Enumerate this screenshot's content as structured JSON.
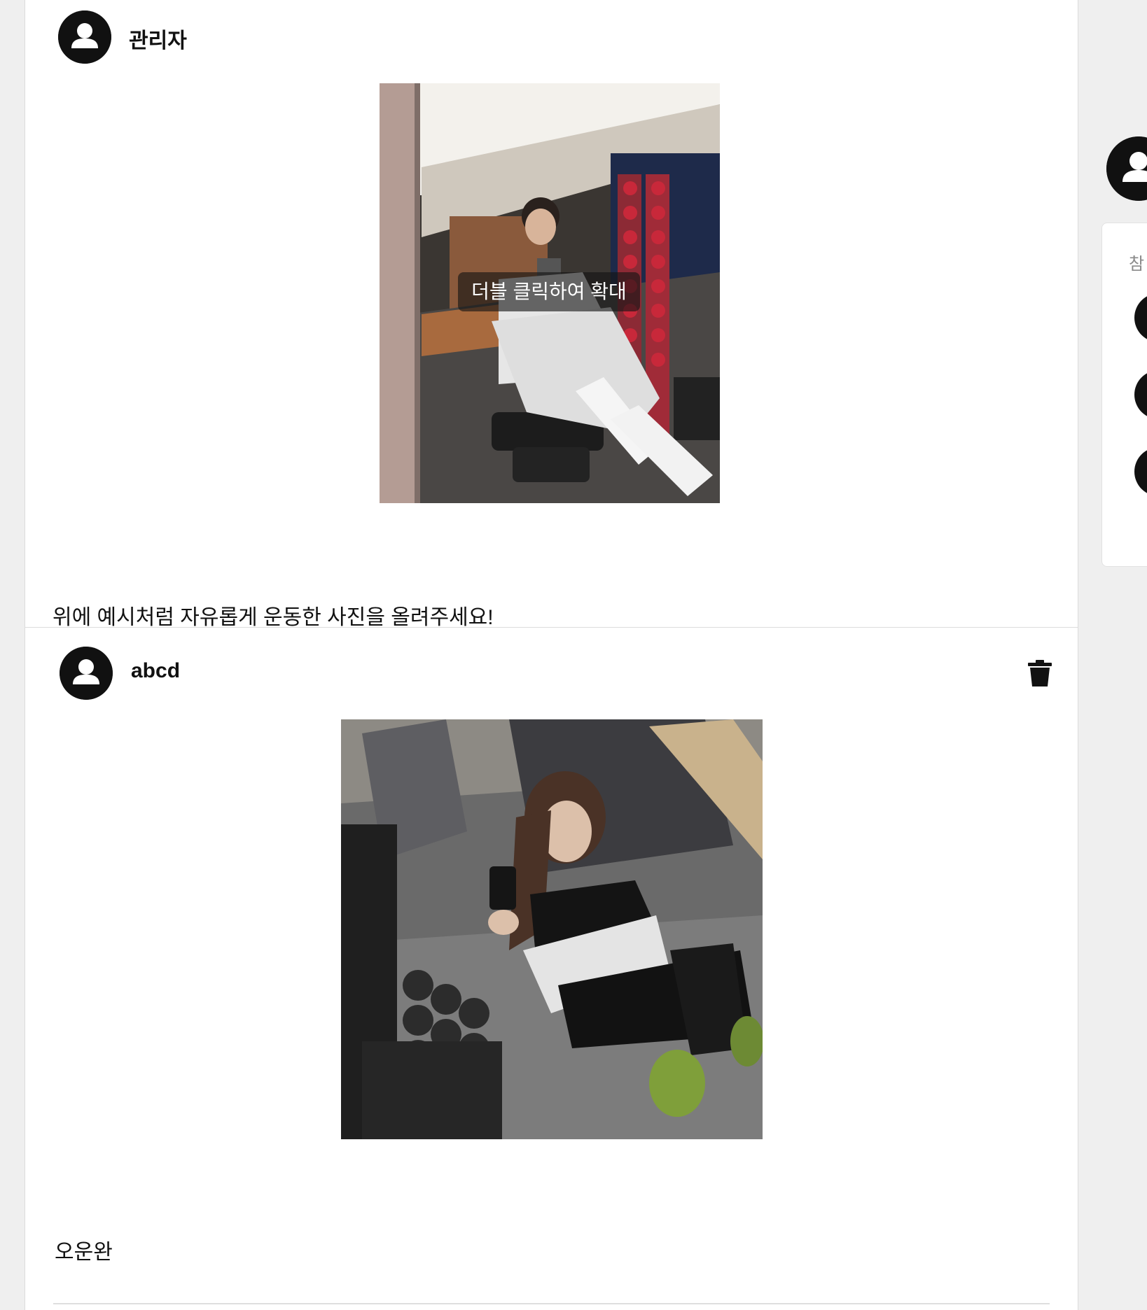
{
  "posts": [
    {
      "author": "관리자",
      "caption": "위에 예시처럼 자유롭게 운동한 사진을 올려주세요!",
      "image_hint": "더블 클릭하여 확대",
      "avatar_icon": "user-avatar-icon",
      "can_delete": false
    },
    {
      "author": "abcd",
      "caption": "오운완",
      "avatar_icon": "user-avatar-icon",
      "delete_icon": "trash-icon",
      "can_delete": true
    }
  ],
  "sidebar": {
    "label": "참",
    "avatar_icon": "user-avatar-icon",
    "participant_count": 3
  }
}
